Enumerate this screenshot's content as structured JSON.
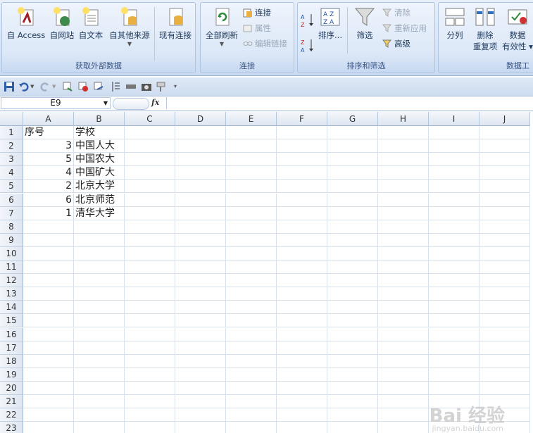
{
  "ribbon": {
    "groups": [
      {
        "label": "获取外部数据"
      },
      {
        "label": "连接"
      },
      {
        "label": "排序和筛选"
      },
      {
        "label": "数据工"
      }
    ],
    "buttons": {
      "access": "自 Access",
      "web": "自网站",
      "text": "自文本",
      "other": "自其他来源",
      "existing": "现有连接",
      "refresh_all": "全部刷新",
      "connections": "连接",
      "properties": "属性",
      "edit_links": "编辑链接",
      "sort": "排序...",
      "filter": "筛选",
      "clear": "清除",
      "reapply": "重新应用",
      "advanced": "高级",
      "split": "分列",
      "remove_dup_1": "删除",
      "remove_dup_2": "重复项",
      "validation_1": "数据",
      "validation_2": "有效性"
    }
  },
  "formula_bar": {
    "name_box": "E9",
    "fx": "fx",
    "formula": ""
  },
  "columns": [
    "A",
    "B",
    "C",
    "D",
    "E",
    "F",
    "G",
    "H",
    "I",
    "J"
  ],
  "rows": [
    "1",
    "2",
    "3",
    "4",
    "5",
    "6",
    "7",
    "8",
    "9",
    "10",
    "11",
    "12",
    "13",
    "14",
    "15",
    "16",
    "17",
    "18",
    "19",
    "20",
    "21",
    "22",
    "23"
  ],
  "cells": {
    "A1": "序号",
    "B1": "学校",
    "A2": "3",
    "B2": "中国人大",
    "A3": "5",
    "B3": "中国农大",
    "A4": "4",
    "B4": "中国矿大",
    "A5": "2",
    "B5": "北京大学",
    "A6": "6",
    "B6": "北京师范",
    "A7": "1",
    "B7": "清华大学"
  },
  "watermark": {
    "main": "Bai 经验",
    "sub": "jingyan.baidu.com"
  },
  "colors": {
    "accent": "#1e395b",
    "ribbon": "#dbe7f7",
    "grid": "#d8e0ea"
  }
}
